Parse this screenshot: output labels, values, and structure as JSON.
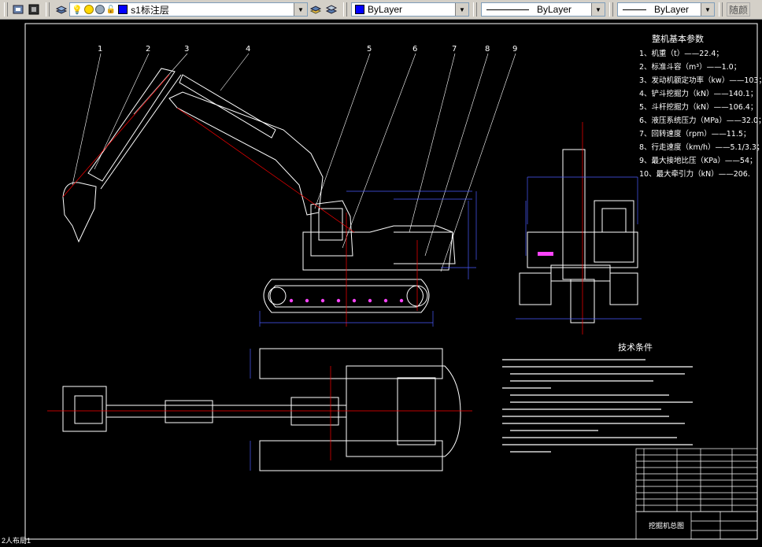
{
  "toolbar": {
    "layer_name": "s1标注层",
    "color_combo": "ByLayer",
    "linetype_combo": "ByLayer",
    "lineweight_combo": "ByLayer",
    "plotstyle_combo": "随颜"
  },
  "drawing": {
    "specs_title": "整机基本参数",
    "specs": [
      "1、机重（t）——22.4；",
      "2、标准斗容（m³）——1.0；",
      "3、发动机额定功率（kw）——103；",
      "4、铲斗挖掘力（kN）——140.1；",
      "5、斗杆挖掘力（kN）——106.4；",
      "6、液压系统压力（MPa）——32.0；",
      "7、回转速度（rpm）——11.5；",
      "8、行走速度（km/h）——5.1/3.3；",
      "9、最大接地比压（KPa）——54；",
      "10、最大牵引力（kN）——206."
    ],
    "tech_title": "技术条件",
    "callouts": [
      "1",
      "2",
      "3",
      "4",
      "5",
      "6",
      "7",
      "8",
      "9"
    ],
    "title_block_name": "挖掘机总图"
  },
  "status_text": "2人布局1"
}
